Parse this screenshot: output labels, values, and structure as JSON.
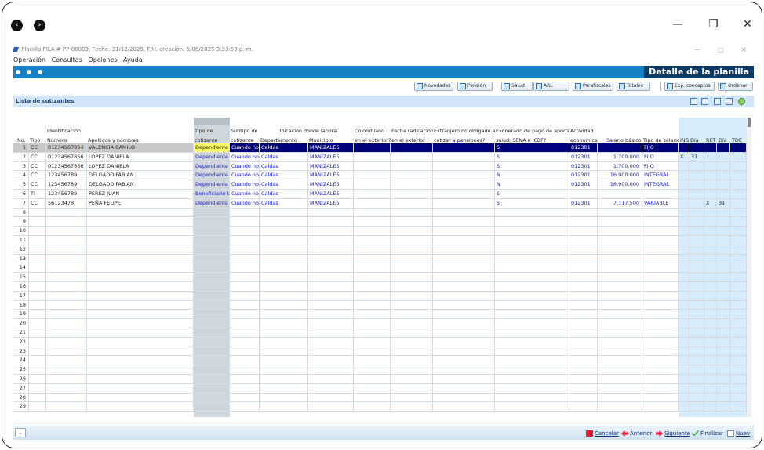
{
  "window": {
    "title": "Planilla PILA # PP-00003, Fecha: 31/12/2025, F/H. creación: 5/06/2025 3:33:59 p. m.",
    "outer_controls": [
      "—",
      "❐",
      "✕"
    ],
    "inner_controls": [
      "—",
      "▢",
      "✕"
    ]
  },
  "menu": [
    "Operación",
    "Consultas",
    "Opciones",
    "Ayuda"
  ],
  "header": {
    "title": "Detalle de la planilla"
  },
  "toolbar": {
    "buttons": [
      "Novedades",
      "Pensión",
      "Salud",
      "ARL",
      "Parafiscales",
      "Totales",
      "Exp. conceptos",
      "Ordenar"
    ]
  },
  "list": {
    "title": "Lista de cotizantes"
  },
  "grid": {
    "group_headers": {
      "tipo_cotizante": "Tipo de",
      "subtipo": "Subtipo de",
      "ubicacion": "Ubicación donde labora",
      "colombiano": "Colombiano",
      "fecha_radicacion": "Fecha radicación",
      "extranjero": "Extranjero no obligado a",
      "exonerado": "Exonerado de pago de aportes",
      "actividad": "Actividad"
    },
    "columns": {
      "no": "No.",
      "tipo": "Tipo",
      "identificacion": "Identificación",
      "numero": "Número",
      "apellidos": "Apellidos y nombres",
      "tipo_cotizante": "cotizante",
      "subtipo": "cotizante",
      "departamento": "Departamento",
      "municipio": "Municipio",
      "colombiano": "en el exterior?",
      "fecha_radicacion": "en el exterior",
      "extranjero": "cotizar a pensiones?",
      "exonerado": "salud, SENA e ICBF?",
      "actividad": "económica",
      "salario": "Salario básico",
      "tipo_salario": "Tipo de salario",
      "ing": "ING",
      "ing_dia": "Día",
      "ret": "RET",
      "ret_dia": "Día",
      "tde": "TDE"
    },
    "rows": [
      {
        "no": "1",
        "tipo": "CC",
        "numero": "01234567854",
        "nombre": "VALENCIA CAMILO",
        "tipo_cot": "Dependiente",
        "subtipo": "Cuando no a",
        "depto": "Caldas",
        "municipio": "MANIZALES",
        "exonerado": "S",
        "actividad": "012301",
        "salario": "",
        "tipo_salario": "FIJO",
        "ing": "",
        "ing_dia": "",
        "ret": "",
        "ret_dia": ""
      },
      {
        "no": "2",
        "tipo": "CC",
        "numero": "01234567856",
        "nombre": "LOPEZ DANIELA",
        "tipo_cot": "Dependiente",
        "subtipo": "Cuando no a",
        "depto": "Caldas",
        "municipio": "MANIZALES",
        "exonerado": "S",
        "actividad": "012301",
        "salario": "1.700.000",
        "tipo_salario": "FIJO",
        "ing": "X",
        "ing_dia": "31",
        "ret": "",
        "ret_dia": ""
      },
      {
        "no": "3",
        "tipo": "CC",
        "numero": "01234567856",
        "nombre": "LOPEZ DANIELA",
        "tipo_cot": "Dependiente",
        "subtipo": "Cuando no a",
        "depto": "Caldas",
        "municipio": "MANIZALES",
        "exonerado": "S",
        "actividad": "012301",
        "salario": "1.700.000",
        "tipo_salario": "FIJO",
        "ing": "",
        "ing_dia": "",
        "ret": "",
        "ret_dia": ""
      },
      {
        "no": "4",
        "tipo": "CC",
        "numero": "123456789",
        "nombre": "DELGADO FABIAN",
        "tipo_cot": "Dependiente",
        "subtipo": "Cuando no a",
        "depto": "Caldas",
        "municipio": "MANIZALES",
        "exonerado": "N",
        "actividad": "012301",
        "salario": "16.900.000",
        "tipo_salario": "INTEGRAL",
        "ing": "",
        "ing_dia": "",
        "ret": "",
        "ret_dia": ""
      },
      {
        "no": "5",
        "tipo": "CC",
        "numero": "123456789",
        "nombre": "DELGADO FABIAN",
        "tipo_cot": "Dependiente",
        "subtipo": "Cuando no a",
        "depto": "Caldas",
        "municipio": "MANIZALES",
        "exonerado": "N",
        "actividad": "012301",
        "salario": "16.900.000",
        "tipo_salario": "INTEGRAL",
        "ing": "",
        "ing_dia": "",
        "ret": "",
        "ret_dia": ""
      },
      {
        "no": "6",
        "tipo": "TI",
        "numero": "123456789",
        "nombre": "PEREZ JUAN",
        "tipo_cot": "Beneficiario UP",
        "subtipo": "Cuando no a",
        "depto": "Caldas",
        "municipio": "MANIZALES",
        "exonerado": "S",
        "actividad": "",
        "salario": "",
        "tipo_salario": "",
        "ing": "",
        "ing_dia": "",
        "ret": "",
        "ret_dia": ""
      },
      {
        "no": "7",
        "tipo": "CC",
        "numero": "56123478",
        "nombre": "PEÑA FELIPE",
        "tipo_cot": "Dependiente",
        "subtipo": "Cuando no a",
        "depto": "Caldas",
        "municipio": "MANIZALES",
        "exonerado": "S",
        "actividad": "012301",
        "salario": "7.117.500",
        "tipo_salario": "VARIABLE",
        "ing": "",
        "ing_dia": "",
        "ret": "X",
        "ret_dia": "31"
      }
    ],
    "empty_row_numbers": [
      "8",
      "9",
      "10",
      "11",
      "12",
      "13",
      "14",
      "15",
      "16",
      "17",
      "18",
      "19",
      "20",
      "21",
      "22",
      "23",
      "24",
      "25",
      "26",
      "27",
      "28",
      "29"
    ]
  },
  "footer": {
    "buttons": [
      "Cancelar",
      "Anterior",
      "Siguiente",
      "Finalizar",
      "Nuev"
    ],
    "left": "⌄"
  },
  "colors": {
    "accent_blue": "#1581c4",
    "header_title_bg": "#0c3a66",
    "selected_row": "#00007a",
    "cell_text_blue": "#1b22c8",
    "shaded_column": "#cfd6dc",
    "light_blue_column": "#d7ecfb",
    "active_cell": "#ffff66"
  }
}
